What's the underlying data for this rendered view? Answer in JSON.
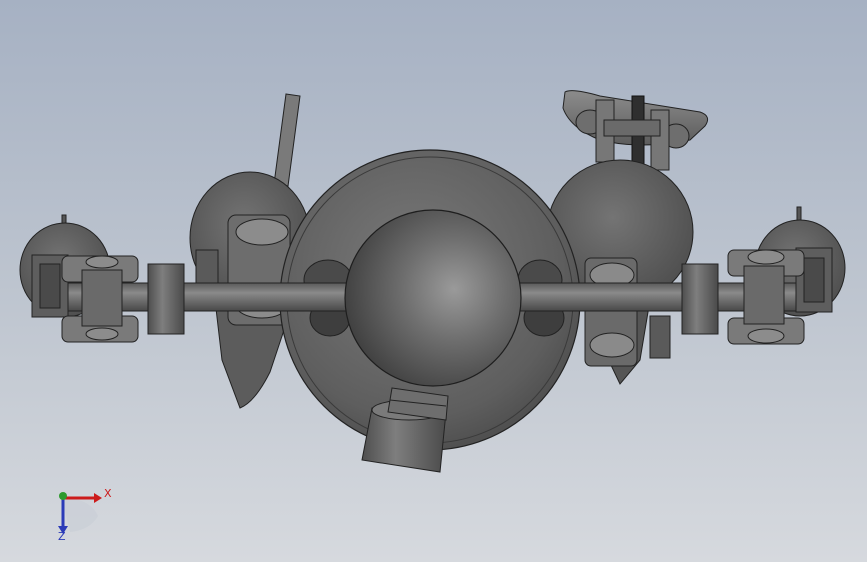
{
  "viewport": {
    "background_top": "#a6b1c3",
    "background_bottom": "#d6d9de",
    "model": "differential-axle-assembly"
  },
  "triad": {
    "x_label": "X",
    "z_label": "Z",
    "x_color": "#cc1b1b",
    "y_color": "#2e9a2e",
    "z_color": "#2b3bb8"
  }
}
